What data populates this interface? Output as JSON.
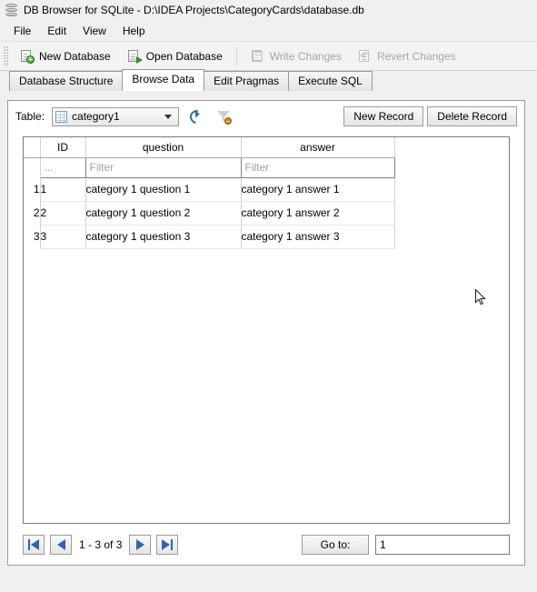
{
  "window": {
    "icon": "database-icon",
    "title": "DB Browser for SQLite - D:\\IDEA Projects\\CategoryCards\\database.db"
  },
  "menubar": {
    "items": [
      {
        "label": "File"
      },
      {
        "label": "Edit"
      },
      {
        "label": "View"
      },
      {
        "label": "Help"
      }
    ]
  },
  "toolbar": {
    "buttons": [
      {
        "label": "New Database",
        "icon": "new-database-icon",
        "enabled": true
      },
      {
        "label": "Open Database",
        "icon": "open-database-icon",
        "enabled": true
      },
      {
        "label": "Write Changes",
        "icon": "write-changes-icon",
        "enabled": false
      },
      {
        "label": "Revert Changes",
        "icon": "revert-changes-icon",
        "enabled": false
      }
    ]
  },
  "tabs": {
    "items": [
      {
        "label": "Database Structure",
        "active": false
      },
      {
        "label": "Browse Data",
        "active": true
      },
      {
        "label": "Edit Pragmas",
        "active": false
      },
      {
        "label": "Execute SQL",
        "active": false
      }
    ]
  },
  "browse_data": {
    "table_label": "Table:",
    "table_selected": "category1",
    "table_icon": "table-grid-icon",
    "refresh_icon": "refresh-icon",
    "clear_filters_icon": "clear-filters-funnel-icon",
    "new_record_label": "New Record",
    "delete_record_label": "Delete Record",
    "grid": {
      "columns": [
        "ID",
        "question",
        "answer"
      ],
      "filters": {
        "id": "...",
        "question_placeholder": "Filter",
        "answer_placeholder": "Filter"
      },
      "rows": [
        {
          "n": "1",
          "id": "1",
          "question": "category 1 question 1",
          "answer": "category 1 answer 1"
        },
        {
          "n": "2",
          "id": "2",
          "question": "category 1 question 2",
          "answer": "category 1 answer 2"
        },
        {
          "n": "3",
          "id": "3",
          "question": "category 1 question 3",
          "answer": "category 1 answer 3"
        }
      ]
    },
    "nav": {
      "first_icon": "go-first-icon",
      "prev_icon": "go-previous-icon",
      "next_icon": "go-next-icon",
      "last_icon": "go-last-icon",
      "position_text": "1 - 3 of 3",
      "goto_label": "Go to:",
      "goto_value": "1"
    }
  },
  "colors": {
    "accent_blue": "#2f63ad",
    "window_bg": "#f0f0f0",
    "panel_bg": "#ffffff",
    "disabled_text": "#a6a6a6",
    "filter_placeholder": "#a0a0a0"
  }
}
